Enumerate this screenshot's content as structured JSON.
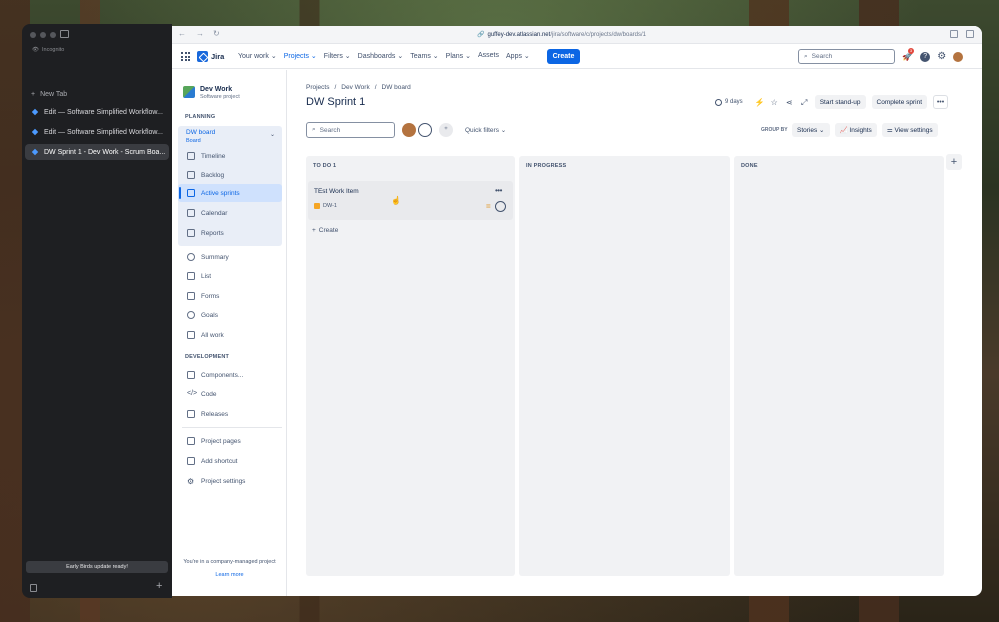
{
  "browser": {
    "incognito_label": "Incognito",
    "new_tab_label": "New Tab",
    "tabs": [
      {
        "title": "Edit — Software Simplified Workflow..."
      },
      {
        "title": "Edit — Software Simplified Workflow..."
      },
      {
        "title": "DW Sprint 1 - Dev Work - Scrum Boa..."
      }
    ],
    "update_label": "Early Birds update ready!",
    "url_host": "guffey-dev.atlassian.net",
    "url_path": "/jira/software/c/projects/dw/boards/1"
  },
  "topnav": {
    "product": "Jira",
    "items": [
      "Your work",
      "Projects",
      "Filters",
      "Dashboards",
      "Teams",
      "Plans",
      "Assets",
      "Apps"
    ],
    "create_label": "Create",
    "search_placeholder": "Search",
    "notification_count": "3"
  },
  "project": {
    "name": "Dev Work",
    "type": "Software project",
    "planning_heading": "PLANNING",
    "board_label": "DW board",
    "board_sub": "Board",
    "planning_items": [
      "Timeline",
      "Backlog",
      "Active sprints",
      "Calendar",
      "Reports"
    ],
    "other_items": [
      "Summary",
      "List",
      "Forms",
      "Goals",
      "All work"
    ],
    "development_heading": "DEVELOPMENT",
    "development_items": [
      "Components...",
      "Code",
      "Releases"
    ],
    "bottom_items": [
      "Project pages",
      "Add shortcut",
      "Project settings"
    ],
    "footnote": "You're in a company-managed project",
    "learn_more": "Learn more"
  },
  "board": {
    "breadcrumb": [
      "Projects",
      "Dev Work",
      "DW board"
    ],
    "title": "DW Sprint 1",
    "days_left": "9 days",
    "start_standup": "Start stand-up",
    "complete_sprint": "Complete sprint",
    "search_placeholder": "Search",
    "quick_filters": "Quick filters",
    "group_by_label": "GROUP BY",
    "group_by_value": "Stories",
    "insights": "Insights",
    "view_settings": "View settings",
    "columns": [
      {
        "title": "TO DO 1"
      },
      {
        "title": "IN PROGRESS"
      },
      {
        "title": "DONE"
      }
    ],
    "card": {
      "title": "TEst Work Item",
      "key": "DW-1"
    },
    "create_label": "Create"
  },
  "colors": {
    "accent": "#0c66e4",
    "active_bg": "#cfe1fd",
    "column_bg": "#f1f2f4"
  }
}
